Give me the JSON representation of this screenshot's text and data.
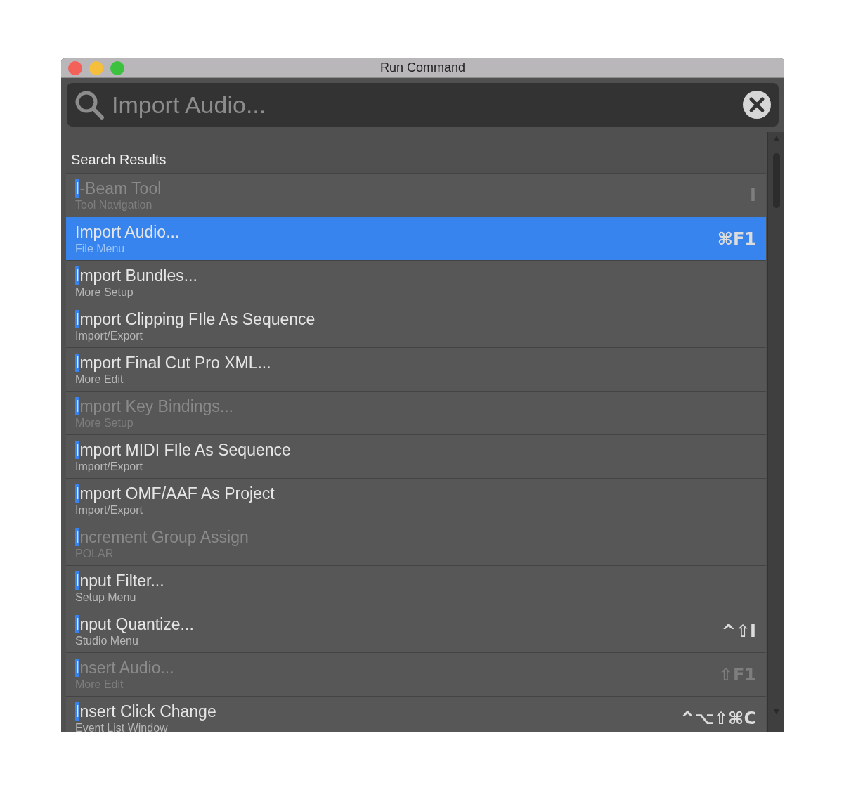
{
  "window": {
    "title": "Run Command"
  },
  "search": {
    "placeholder": "Import Audio..."
  },
  "results": {
    "heading": "Search Results",
    "items": [
      {
        "title": "I-Beam Tool",
        "category": "Tool Navigation",
        "shortcut": "I",
        "disabled": true,
        "selected": false
      },
      {
        "title": "Import Audio...",
        "category": "File Menu",
        "shortcut": "⌘F1",
        "disabled": false,
        "selected": true
      },
      {
        "title": "Import Bundles...",
        "category": "More Setup",
        "disabled": false,
        "selected": false
      },
      {
        "title": "Import Clipping FIle As Sequence",
        "category": "Import/Export",
        "disabled": false,
        "selected": false
      },
      {
        "title": "Import Final Cut Pro XML...",
        "category": "More Edit",
        "disabled": false,
        "selected": false
      },
      {
        "title": "Import Key Bindings...",
        "category": "More Setup",
        "disabled": true,
        "selected": false
      },
      {
        "title": "Import MIDI FIle As Sequence",
        "category": "Import/Export",
        "disabled": false,
        "selected": false
      },
      {
        "title": "Import OMF/AAF As Project",
        "category": "Import/Export",
        "disabled": false,
        "selected": false
      },
      {
        "title": "Increment Group Assign",
        "category": "POLAR",
        "disabled": true,
        "selected": false
      },
      {
        "title": "Input Filter...",
        "category": "Setup Menu",
        "disabled": false,
        "selected": false
      },
      {
        "title": "Input Quantize...",
        "category": "Studio Menu",
        "shortcut": "^⇧I",
        "disabled": false,
        "selected": false
      },
      {
        "title": "Insert Audio...",
        "category": "More Edit",
        "shortcut": "⇧F1",
        "disabled": true,
        "selected": false
      },
      {
        "title": "Insert Click Change",
        "category": "Event List Window",
        "shortcut": "^⌥⇧⌘C",
        "disabled": false,
        "selected": false
      }
    ]
  }
}
